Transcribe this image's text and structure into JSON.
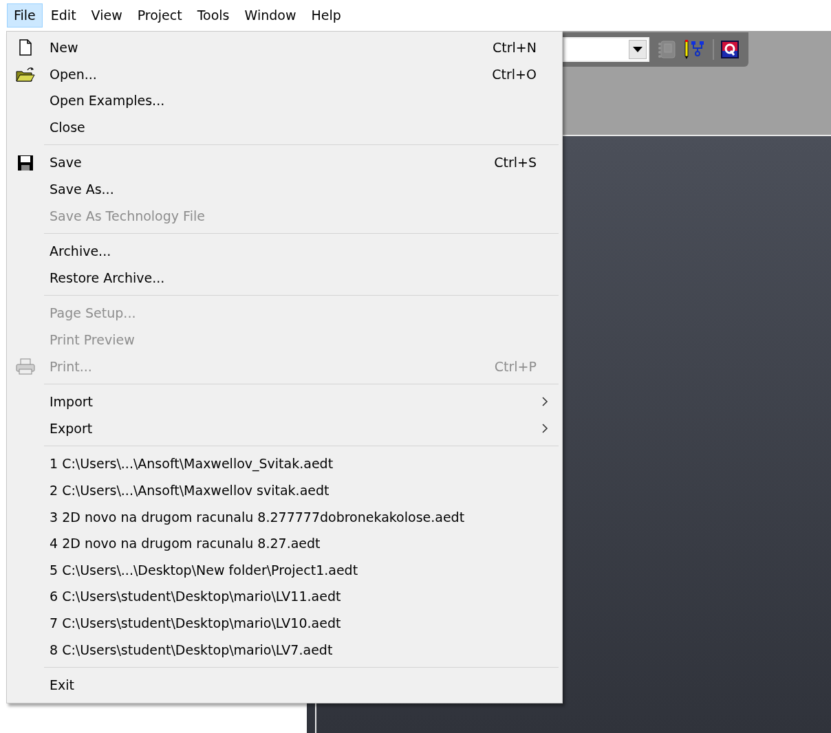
{
  "menubar": [
    {
      "label": "File",
      "selected": true
    },
    {
      "label": "Edit",
      "selected": false
    },
    {
      "label": "View",
      "selected": false
    },
    {
      "label": "Project",
      "selected": false
    },
    {
      "label": "Tools",
      "selected": false
    },
    {
      "label": "Window",
      "selected": false
    },
    {
      "label": "Help",
      "selected": false
    }
  ],
  "file_menu": [
    {
      "kind": "item",
      "label": "New",
      "shortcut": "Ctrl+N",
      "disabled": false
    },
    {
      "kind": "item",
      "label": "Open...",
      "shortcut": "Ctrl+O",
      "disabled": false
    },
    {
      "kind": "item",
      "label": "Open Examples...",
      "disabled": false
    },
    {
      "kind": "item",
      "label": "Close",
      "disabled": false
    },
    {
      "kind": "separator"
    },
    {
      "kind": "item",
      "label": "Save",
      "shortcut": "Ctrl+S",
      "disabled": false
    },
    {
      "kind": "item",
      "label": "Save As...",
      "disabled": false
    },
    {
      "kind": "item",
      "label": "Save As Technology File",
      "disabled": true
    },
    {
      "kind": "separator"
    },
    {
      "kind": "item",
      "label": "Archive...",
      "disabled": false
    },
    {
      "kind": "item",
      "label": "Restore Archive...",
      "disabled": false
    },
    {
      "kind": "separator"
    },
    {
      "kind": "item",
      "label": "Page Setup...",
      "disabled": true
    },
    {
      "kind": "item",
      "label": "Print Preview",
      "disabled": true
    },
    {
      "kind": "item",
      "label": "Print...",
      "shortcut": "Ctrl+P",
      "disabled": true
    },
    {
      "kind": "separator"
    },
    {
      "kind": "item",
      "label": "Import",
      "submenu": true,
      "disabled": false
    },
    {
      "kind": "item",
      "label": "Export",
      "submenu": true,
      "disabled": false
    },
    {
      "kind": "separator"
    },
    {
      "kind": "item",
      "label": "1 C:\\Users\\...\\Ansoft\\Maxwellov_Svitak.aedt",
      "disabled": false
    },
    {
      "kind": "item",
      "label": "2 C:\\Users\\...\\Ansoft\\Maxwellov svitak.aedt",
      "disabled": false
    },
    {
      "kind": "item",
      "label": "3 2D novo na drugom racunalu 8.277777dobronekakolose.aedt",
      "disabled": false
    },
    {
      "kind": "item",
      "label": "4 2D novo na drugom racunalu 8.27.aedt",
      "disabled": false
    },
    {
      "kind": "item",
      "label": "5 C:\\Users\\...\\Desktop\\New folder\\Project1.aedt",
      "disabled": false
    },
    {
      "kind": "item",
      "label": "6 C:\\Users\\student\\Desktop\\mario\\LV11.aedt",
      "disabled": false
    },
    {
      "kind": "item",
      "label": "7 C:\\Users\\student\\Desktop\\mario\\LV10.aedt",
      "disabled": false
    },
    {
      "kind": "item",
      "label": "8 C:\\Users\\student\\Desktop\\mario\\LV7.aedt",
      "disabled": false
    },
    {
      "kind": "separator"
    },
    {
      "kind": "item",
      "label": "Exit",
      "disabled": false
    }
  ],
  "toolbar": {
    "tools": [
      {
        "kind": "tool",
        "disabled": true
      },
      {
        "kind": "tool",
        "disabled": false
      },
      {
        "kind": "separator"
      },
      {
        "kind": "tool",
        "disabled": false
      }
    ]
  }
}
